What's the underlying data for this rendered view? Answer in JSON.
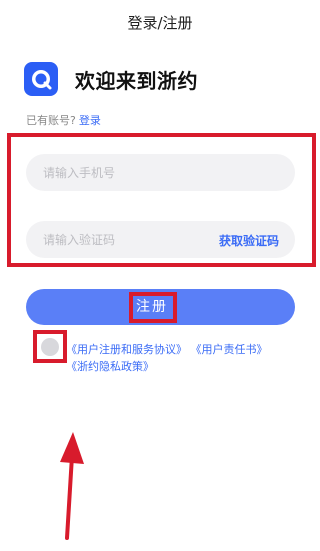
{
  "header": {
    "title": "登录/注册"
  },
  "brand": {
    "logo_icon": "app-logo-icon",
    "welcome": "欢迎来到浙约"
  },
  "account": {
    "prompt": "已有账号?",
    "login_link": "登录"
  },
  "form": {
    "phone_placeholder": "请输入手机号",
    "code_placeholder": "请输入验证码",
    "get_code_label": "获取验证码",
    "register_label": "注册"
  },
  "agreement": {
    "user_agreement": "《用户注册和服务协议》",
    "responsibility": "《用户责任书》",
    "privacy": "《浙约隐私政策》"
  },
  "colors": {
    "accent": "#3b6cf6",
    "button": "#5a7ff7",
    "annotation": "#d81b2c"
  }
}
